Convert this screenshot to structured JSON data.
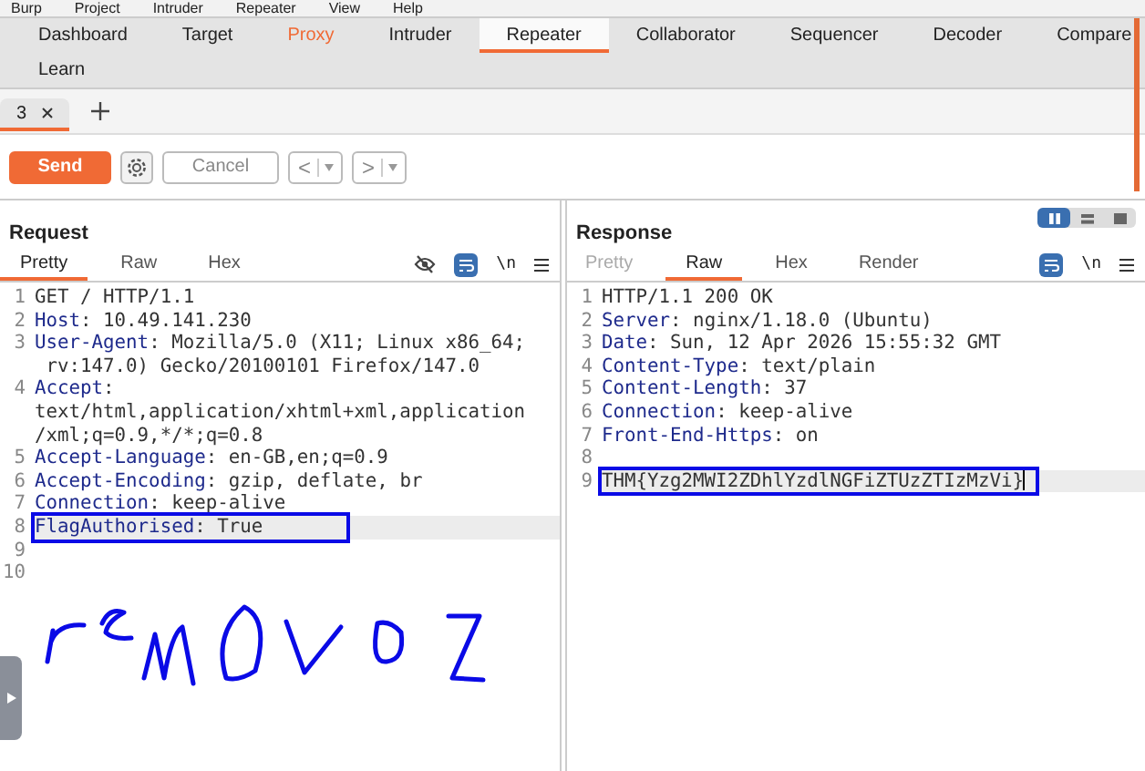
{
  "menu": [
    "Burp",
    "Project",
    "Intruder",
    "Repeater",
    "View",
    "Help"
  ],
  "tool_rows": [
    [
      {
        "label": "Dashboard",
        "selected": false,
        "highlighted": false
      },
      {
        "label": "Target",
        "selected": false,
        "highlighted": false
      },
      {
        "label": "Proxy",
        "selected": false,
        "highlighted": true
      },
      {
        "label": "Intruder",
        "selected": false,
        "highlighted": false
      },
      {
        "label": "Repeater",
        "selected": true,
        "highlighted": false
      },
      {
        "label": "Collaborator",
        "selected": false,
        "highlighted": false
      },
      {
        "label": "Sequencer",
        "selected": false,
        "highlighted": false
      },
      {
        "label": "Decoder",
        "selected": false,
        "highlighted": false
      },
      {
        "label": "Compare",
        "selected": false,
        "highlighted": false
      }
    ],
    [
      {
        "label": "Learn",
        "selected": false,
        "highlighted": false
      }
    ]
  ],
  "repeater_tabs": [
    {
      "label": "3",
      "selected": true
    }
  ],
  "toolbar": {
    "send": "Send",
    "cancel": "Cancel",
    "cancel_disabled": true,
    "back": "<",
    "forward": ">"
  },
  "layout_toggle": [
    {
      "selected": true
    },
    {
      "selected": false
    },
    {
      "selected": false
    }
  ],
  "panels": [
    {
      "title": "Request",
      "tabs": [
        {
          "label": "Pretty",
          "selected": true,
          "disabled": false
        },
        {
          "label": "Raw",
          "selected": false,
          "disabled": false
        },
        {
          "label": "Hex",
          "selected": false,
          "disabled": false
        }
      ],
      "hide_icon": true,
      "newline": "\\n",
      "lines": [
        {
          "number": "1",
          "value": "GET / HTTP/1.1"
        },
        {
          "number": "2",
          "name": "Host",
          "value": ": 10.49.141.230"
        },
        {
          "number": "3",
          "name": "User-Agent",
          "value": ": Mozilla/5.0 (X11; Linux x86_64;",
          "wrap": [
            " rv:147.0) Gecko/20100101 Firefox/147.0"
          ]
        },
        {
          "number": "4",
          "name": "Accept",
          "value": ":",
          "wrap": [
            "text/html,application/xhtml+xml,application",
            "/xml;q=0.9,*/*;q=0.8"
          ]
        },
        {
          "number": "5",
          "name": "Accept-Language",
          "value": ": en-GB,en;q=0.9"
        },
        {
          "number": "6",
          "name": "Accept-Encoding",
          "value": ": gzip, deflate, br"
        },
        {
          "number": "7",
          "name": "Connection",
          "value": ": keep-alive"
        },
        {
          "number": "8",
          "name": "FlagAuthorised",
          "value": ": True",
          "current": true,
          "boxed": true
        },
        {
          "number": "9"
        },
        {
          "number": "10"
        }
      ]
    },
    {
      "title": "Response",
      "tabs": [
        {
          "label": "Pretty",
          "selected": false,
          "disabled": true
        },
        {
          "label": "Raw",
          "selected": true,
          "disabled": false
        },
        {
          "label": "Hex",
          "selected": false,
          "disabled": false
        },
        {
          "label": "Render",
          "selected": false,
          "disabled": false
        }
      ],
      "newline": "\\n",
      "lines": [
        {
          "number": "1",
          "value": "HTTP/1.1 200 OK"
        },
        {
          "number": "2",
          "name": "Server",
          "value": ": nginx/1.18.0 (Ubuntu)"
        },
        {
          "number": "3",
          "name": "Date",
          "value": ": Sun, 12 Apr 2026 15:55:32 GMT"
        },
        {
          "number": "4",
          "name": "Content-Type",
          "value": ": text/plain"
        },
        {
          "number": "5",
          "name": "Content-Length",
          "value": ": 37"
        },
        {
          "number": "6",
          "name": "Connection",
          "value": ": keep-alive"
        },
        {
          "number": "7",
          "name": "Front-End-Https",
          "value": ": on"
        },
        {
          "number": "8"
        },
        {
          "number": "9",
          "value": "THM{Yzg2MWI2ZDhlYzdlNGFiZTUzZTIzMzVi}",
          "current": true,
          "boxed": true
        }
      ]
    }
  ]
}
